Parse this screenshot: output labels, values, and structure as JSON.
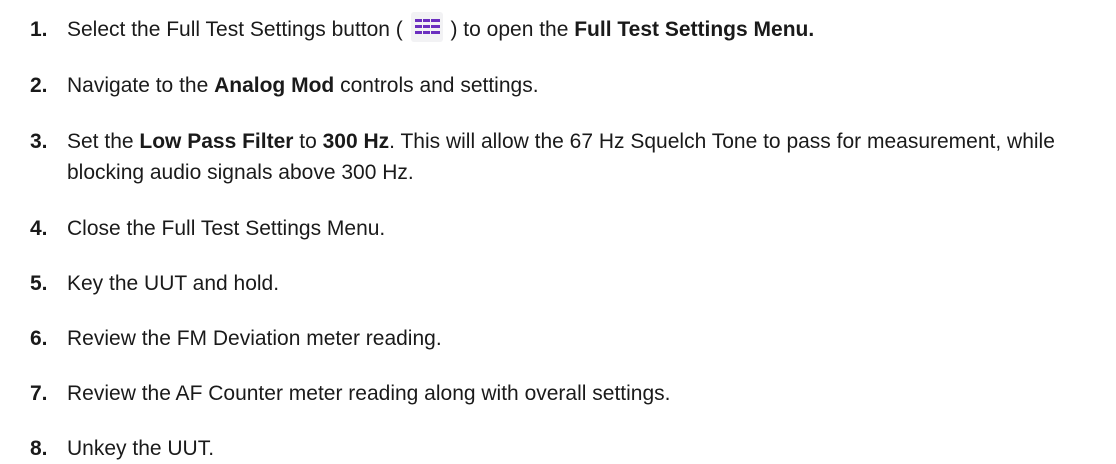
{
  "steps": [
    {
      "num": "1.",
      "parts": [
        {
          "t": "Select the Full Test Settings button ( "
        },
        {
          "icon": "full-test-settings-icon"
        },
        {
          "t": " ) to open the "
        },
        {
          "b": "Full Test Settings Menu."
        }
      ]
    },
    {
      "num": "2.",
      "parts": [
        {
          "t": "Navigate to the "
        },
        {
          "b": "Analog Mod"
        },
        {
          "t": " controls and settings."
        }
      ]
    },
    {
      "num": "3.",
      "parts": [
        {
          "t": "Set the "
        },
        {
          "b": "Low Pass Filter"
        },
        {
          "t": " to "
        },
        {
          "b": "300 Hz"
        },
        {
          "t": ". This will allow the 67 Hz Squelch Tone to pass for measurement, while blocking audio signals above 300 Hz."
        }
      ]
    },
    {
      "num": "4.",
      "parts": [
        {
          "t": "Close the Full Test Settings Menu."
        }
      ]
    },
    {
      "num": "5.",
      "parts": [
        {
          "t": "Key the UUT and hold."
        }
      ]
    },
    {
      "num": "6.",
      "parts": [
        {
          "t": "Review the FM Deviation meter reading."
        }
      ]
    },
    {
      "num": "7.",
      "parts": [
        {
          "t": "Review the AF Counter meter reading along with overall settings."
        }
      ]
    },
    {
      "num": "8.",
      "parts": [
        {
          "t": "Unkey the UUT."
        }
      ]
    }
  ],
  "colors": {
    "text": "#1a1a1a",
    "icon": "#6b2fbf",
    "icon_bg": "#f2f2f4"
  }
}
